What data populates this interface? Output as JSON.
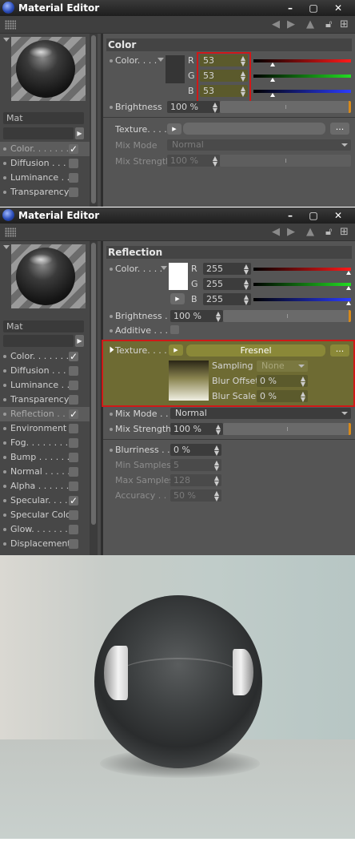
{
  "window1": {
    "title": "Material Editor",
    "material_name": "Mat",
    "section_title": "Color",
    "color_label": "Color. . . .",
    "rgb": {
      "r_label": "R",
      "g_label": "G",
      "b_label": "B",
      "r": "53",
      "g": "53",
      "b": "53"
    },
    "swatch_color": "#353535",
    "brightness_label": "Brightness",
    "brightness_value": "100 %",
    "texture_label": "Texture. . . .",
    "mix_mode_label": "Mix Mode",
    "mix_mode_value": "Normal",
    "mix_strength_label": "Mix Strength",
    "mix_strength_value": "100 %",
    "ellipsis": "...",
    "channels": [
      {
        "label": "Color. . . . . . .",
        "checked": true,
        "selected": true
      },
      {
        "label": "Diffusion . . . . .",
        "checked": false
      },
      {
        "label": "Luminance . . .",
        "checked": false
      },
      {
        "label": "Transparency",
        "checked": false
      }
    ]
  },
  "window2": {
    "title": "Material Editor",
    "material_name": "Mat",
    "section_title": "Reflection",
    "color_label": "Color. . . . .",
    "rgb": {
      "r_label": "R",
      "g_label": "G",
      "b_label": "B",
      "r": "255",
      "g": "255",
      "b": "255"
    },
    "swatch_color": "#ffffff",
    "brightness_label": "Brightness . .",
    "brightness_value": "100 %",
    "additive_label": "Additive . . . .",
    "texture_label": "Texture. . . . .",
    "texture_shader": "Fresnel",
    "ellipsis": "...",
    "sampling_label": "Sampling",
    "sampling_value": "None",
    "blur_offset_label": "Blur Offset",
    "blur_offset_value": "0 %",
    "blur_scale_label": "Blur Scale",
    "blur_scale_value": "0 %",
    "mix_mode_label": "Mix Mode . . .",
    "mix_mode_value": "Normal",
    "mix_strength_label": "Mix Strength",
    "mix_strength_value": "100 %",
    "blurriness_label": "Blurriness . . .",
    "blurriness_value": "0 %",
    "min_samples_label": "Min Samples",
    "min_samples_value": "5",
    "max_samples_label": "Max Samples",
    "max_samples_value": "128",
    "accuracy_label": "Accuracy . . .",
    "accuracy_value": "50 %",
    "channels": [
      {
        "label": "Color. . . . . . .",
        "checked": true
      },
      {
        "label": "Diffusion . . . . .",
        "checked": false
      },
      {
        "label": "Luminance . . .",
        "checked": false
      },
      {
        "label": "Transparency",
        "checked": false
      },
      {
        "label": "Reflection . . .",
        "checked": true,
        "selected": true
      },
      {
        "label": "Environment",
        "checked": false
      },
      {
        "label": "Fog. . . . . . . .",
        "checked": false
      },
      {
        "label": "Bump . . . . . .",
        "checked": false
      },
      {
        "label": "Normal . . . . . .",
        "checked": false
      },
      {
        "label": "Alpha . . . . . .",
        "checked": false
      },
      {
        "label": "Specular. . . . .",
        "checked": true
      },
      {
        "label": "Specular Color",
        "checked": false
      },
      {
        "label": "Glow. . . . . . . .",
        "checked": false
      },
      {
        "label": "Displacement",
        "checked": false
      }
    ]
  },
  "icons": [
    "app-icon",
    "minimize-icon",
    "maximize-icon",
    "close-icon",
    "grid-menu-icon",
    "back-arrow-icon",
    "forward-arrow-icon",
    "pin-icon",
    "lock-icon",
    "new-window-icon",
    "checkmark-icon",
    "play-arrow-icon",
    "dropdown-caret-icon"
  ],
  "colors": {
    "highlight_red": "#d01818",
    "olive_highlight": "#6e6b33",
    "accent_orange": "#d88a1a"
  }
}
